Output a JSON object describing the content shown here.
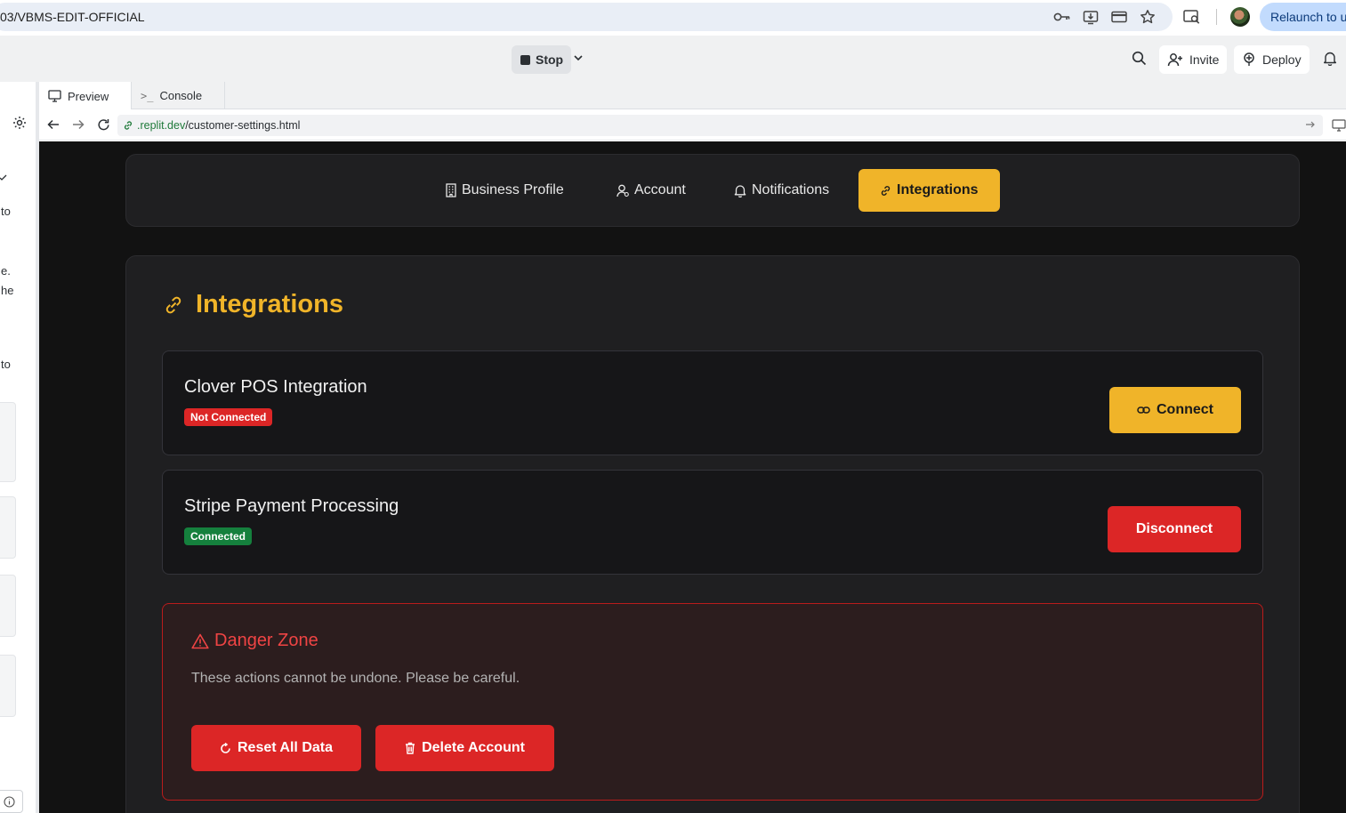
{
  "browser": {
    "url": "03/VBMS-EDIT-OFFICIAL",
    "relaunch_label": "Relaunch to up"
  },
  "workspace": {
    "stop_label": "Stop",
    "invite_label": "Invite",
    "deploy_label": "Deploy"
  },
  "left_panel": {
    "snippets": [
      "to",
      "e.",
      "he",
      "to"
    ]
  },
  "pane_tabs": [
    {
      "label": "Preview"
    },
    {
      "label": "Console"
    }
  ],
  "preview_nav": {
    "url_domain": ".replit.dev",
    "url_path": "/customer-settings.html"
  },
  "settings": {
    "tabs": [
      {
        "label": "Business Profile",
        "icon": "building-icon"
      },
      {
        "label": "Account",
        "icon": "user-icon"
      },
      {
        "label": "Notifications",
        "icon": "bell-icon"
      },
      {
        "label": "Integrations",
        "icon": "link-icon",
        "active": true
      }
    ],
    "section_title": "Integrations",
    "integrations": [
      {
        "name": "Clover POS Integration",
        "status": "Not Connected",
        "action": "Connect"
      },
      {
        "name": "Stripe Payment Processing",
        "status": "Connected",
        "action": "Disconnect"
      }
    ],
    "danger_zone": {
      "title": "Danger Zone",
      "description": "These actions cannot be undone. Please be careful.",
      "reset_label": "Reset All Data",
      "delete_label": "Delete Account"
    }
  },
  "colors": {
    "accent": "#f0b429",
    "danger": "#dc2626",
    "success": "#15803d",
    "app_background": "#121212",
    "card_background": "#1f1f21"
  }
}
